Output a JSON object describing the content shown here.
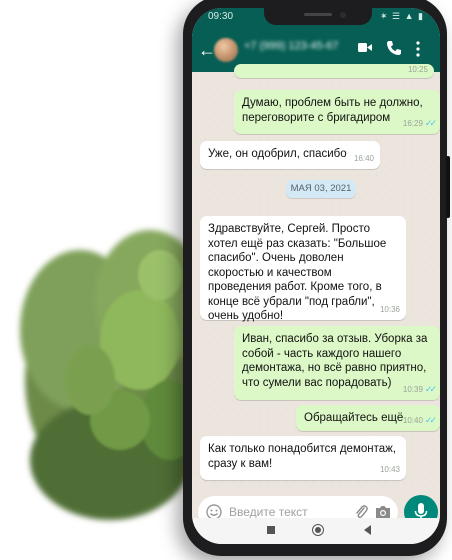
{
  "status_bar": {
    "time": "09:30",
    "icons": "✶ ☰ ▲ ▮"
  },
  "header": {
    "contact_name": "+7 (999) 123-45-67"
  },
  "messages": [
    {
      "direction": "out",
      "text": "10:25",
      "time": ""
    },
    {
      "direction": "out",
      "text": "Думаю, проблем быть не должно, переговорите с бригадиром",
      "time": "16:29",
      "read": true
    },
    {
      "direction": "in",
      "text": "Уже, он одобрил, спасибо",
      "time": "16:40"
    },
    {
      "direction": "out",
      "text": "Здравствуйте, Сергей. Просто хотел ещё раз сказать: \"Большое спасибо\". Очень доволен скоростью и качеством проведения работ. Кроме того, в конце всё убрали \"под грабли\", очень удобно!",
      "time": "10:36"
    },
    {
      "direction": "out",
      "text": "Иван, спасибо за отзыв. Уборка за собой - часть каждого нашего демонтажа, но всё равно приятно, что сумели вас порадовать)",
      "time": "10:39",
      "read": true
    },
    {
      "direction": "out",
      "text": "Обращайтесь ещё",
      "time": "10:40",
      "read": true
    },
    {
      "direction": "in",
      "text": "Как только понадобится демонтаж, сразу к вам!",
      "time": "10:43"
    }
  ],
  "date_separator": "МАЯ 03, 2021",
  "input": {
    "placeholder": "Введите текст"
  },
  "colors": {
    "header": "#075e54",
    "outgoing_bubble": "#dcf8c6",
    "incoming_bubble": "#ffffff",
    "mic_button": "#00897b",
    "read_tick": "#4fc3f7"
  }
}
